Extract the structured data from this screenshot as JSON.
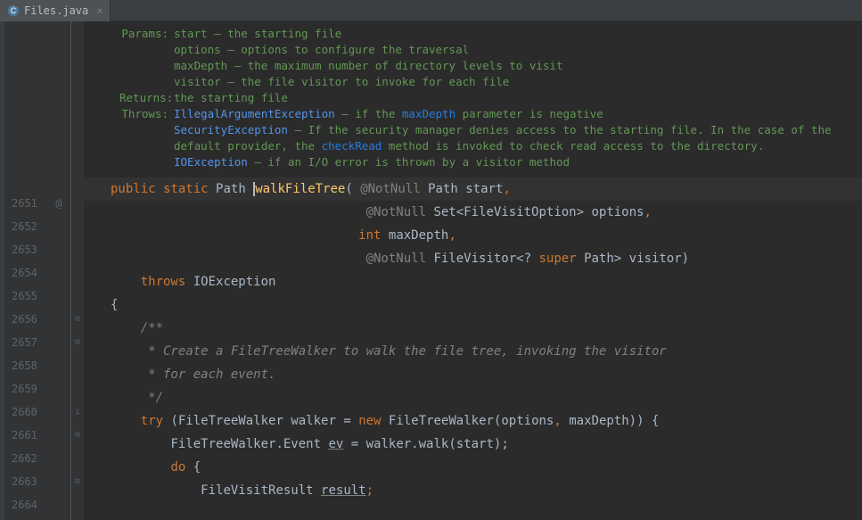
{
  "tab": {
    "filename": "Files.java",
    "icon_name": "java-class-icon"
  },
  "javadoc": {
    "params_label": "Params:",
    "params": [
      "start – the starting file",
      "options – options to configure the traversal",
      "maxDepth – the maximum number of directory levels to visit",
      "visitor – the file visitor to invoke for each file"
    ],
    "returns_label": "Returns:",
    "returns": "the starting file",
    "throws_label": "Throws:",
    "throws": {
      "ex1": "IllegalArgumentException",
      "ex1_desc": " – if the ",
      "ex1_code": "maxDepth",
      "ex1_desc2": " parameter is negative",
      "ex2": "SecurityException",
      "ex2_desc": " – If the security manager denies access to the starting file. In the case of the default provider, the ",
      "ex2_code": "checkRead",
      "ex2_desc2": " method is invoked to check read access to the directory.",
      "ex3": "IOException",
      "ex3_desc": " – if an I/O error is thrown by a visitor method"
    }
  },
  "lines": {
    "l2651": "2651",
    "l2652": "2652",
    "l2653": "2653",
    "l2654": "2654",
    "l2655": "2655",
    "l2656": "2656",
    "l2657": "2657",
    "l2658": "2658",
    "l2659": "2659",
    "l2660": "2660",
    "l2661": "2661",
    "l2662": "2662",
    "l2663": "2663",
    "l2664": "2664"
  },
  "code": {
    "l2651": {
      "kw1": "public",
      "kw2": "static",
      "type": "Path",
      "method": "walkFileTree",
      "anno": "@NotNull",
      "ptype": "Path",
      "pname": "start",
      "comma": ","
    },
    "l2652": {
      "anno": "@NotNull",
      "ptype": "Set<FileVisitOption>",
      "pname": "options",
      "comma": ","
    },
    "l2653": {
      "kw": "int",
      "pname": "maxDepth",
      "comma": ","
    },
    "l2654": {
      "anno": "@NotNull",
      "ptype": "FileVisitor<?",
      "kw": "super",
      "ptype2": "Path>",
      "pname": "visitor",
      "paren": ")"
    },
    "l2655": {
      "kw": "throws",
      "type": "IOException"
    },
    "l2656": {
      "brace": "{"
    },
    "l2657": {
      "c": "/**"
    },
    "l2658": {
      "c": " * Create a FileTreeWalker to walk the file tree, invoking the visitor"
    },
    "l2659": {
      "c": " * for each event."
    },
    "l2660": {
      "c": " */"
    },
    "l2661": {
      "kw1": "try",
      "paren1": "(FileTreeWalker walker =",
      "kw2": "new",
      "call": "FileTreeWalker(options",
      "comma": ",",
      "arg2": "maxDepth)) {"
    },
    "l2662": {
      "type": "FileTreeWalker.Event",
      "var": "ev",
      "rest": " = walker.walk(start);"
    },
    "l2663": {
      "kw": "do",
      "brace": "{"
    },
    "l2664": {
      "type": "FileVisitResult",
      "var": "result",
      "semi": ";"
    }
  },
  "gutter": {
    "at_symbol": "@"
  }
}
